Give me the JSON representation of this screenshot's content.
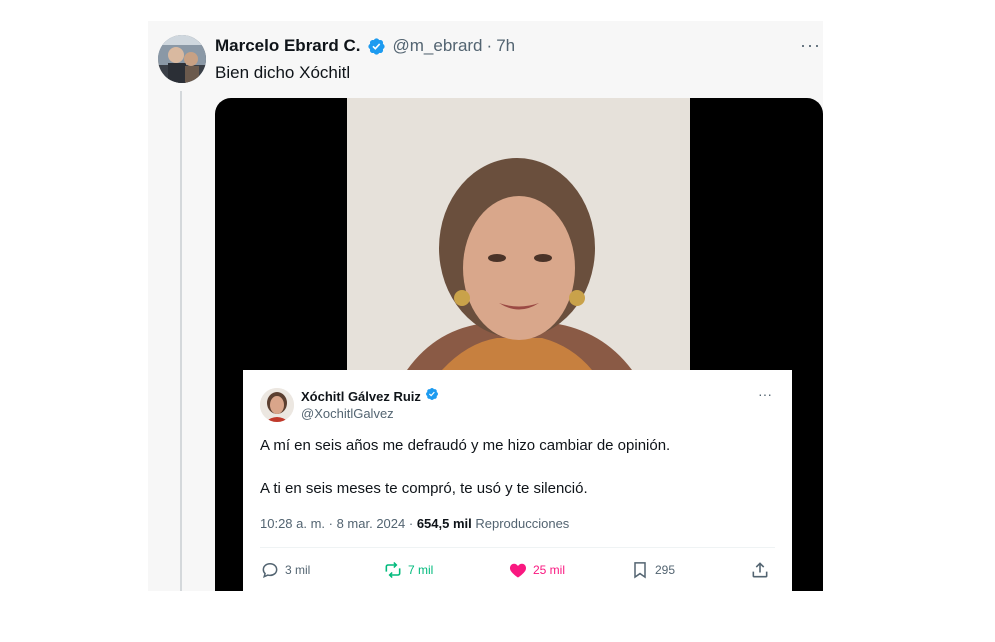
{
  "tweet": {
    "author_name": "Marcelo Ebrard C.",
    "handle": "@m_ebrard",
    "separator": "·",
    "time": "7h",
    "more": "···",
    "text": "Bien dicho Xóchitl"
  },
  "embedded_tweet": {
    "author_name": "Xóchitl Gálvez Ruiz",
    "handle": "@XochitlGalvez",
    "more": "···",
    "text_line1": "A mí en seis años me defraudó y me hizo cambiar de opinión.",
    "text_line2": "A ti en seis meses te compró, te usó y te silenció.",
    "timestamp": "10:28 a. m. · 8 mar. 2024 · ",
    "views": "654,5 mil",
    "views_label": " Reproducciones",
    "replies": "3 mil",
    "reposts": "7 mil",
    "likes": "25 mil",
    "bookmarks": "295"
  },
  "colors": {
    "verified": "#1d9bf0",
    "repost": "#00ba7c",
    "like": "#f91880",
    "muted": "#536471"
  }
}
